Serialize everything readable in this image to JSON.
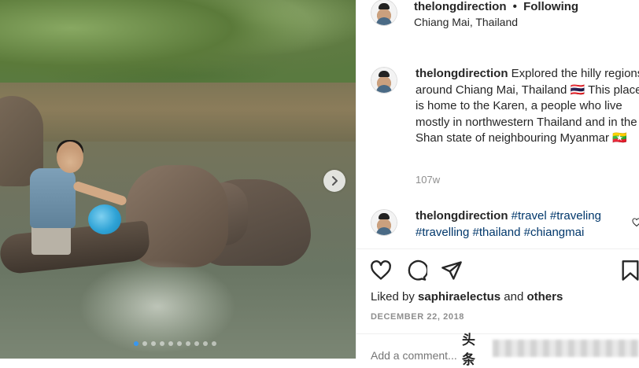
{
  "post": {
    "username": "thelongdirection",
    "separator": "•",
    "follow_status": "Following",
    "location": "Chiang Mai, Thailand",
    "caption": {
      "username": "thelongdirection",
      "text": " Explored the hilly regions around Chiang Mai, Thailand 🇹🇭 This place is home to the Karen, a people who live mostly in northwestern Thailand and in the Shan state of neighbouring Myanmar 🇲🇲",
      "time_ago": "107w"
    },
    "comment": {
      "username": "thelongdirection",
      "hashtags": [
        "#travel",
        "#traveling",
        "#travelling",
        "#thailand",
        "#chiangmai"
      ]
    },
    "likes": {
      "prefix": "Liked by ",
      "user": "saphiraelectus",
      "middle": " and ",
      "others": "others"
    },
    "date": "DECEMBER 22, 2018",
    "add_comment_placeholder": "Add a comment...",
    "watermark_text": "头条"
  },
  "carousel": {
    "total_slides": 10,
    "active_index": 0
  },
  "colors": {
    "hashtag": "#00376b",
    "active_dot": "#3897f0",
    "secondary_text": "#8e8e8e"
  },
  "icons": [
    "chevron-right-icon",
    "heart-icon",
    "comment-icon",
    "share-icon",
    "bookmark-icon"
  ]
}
